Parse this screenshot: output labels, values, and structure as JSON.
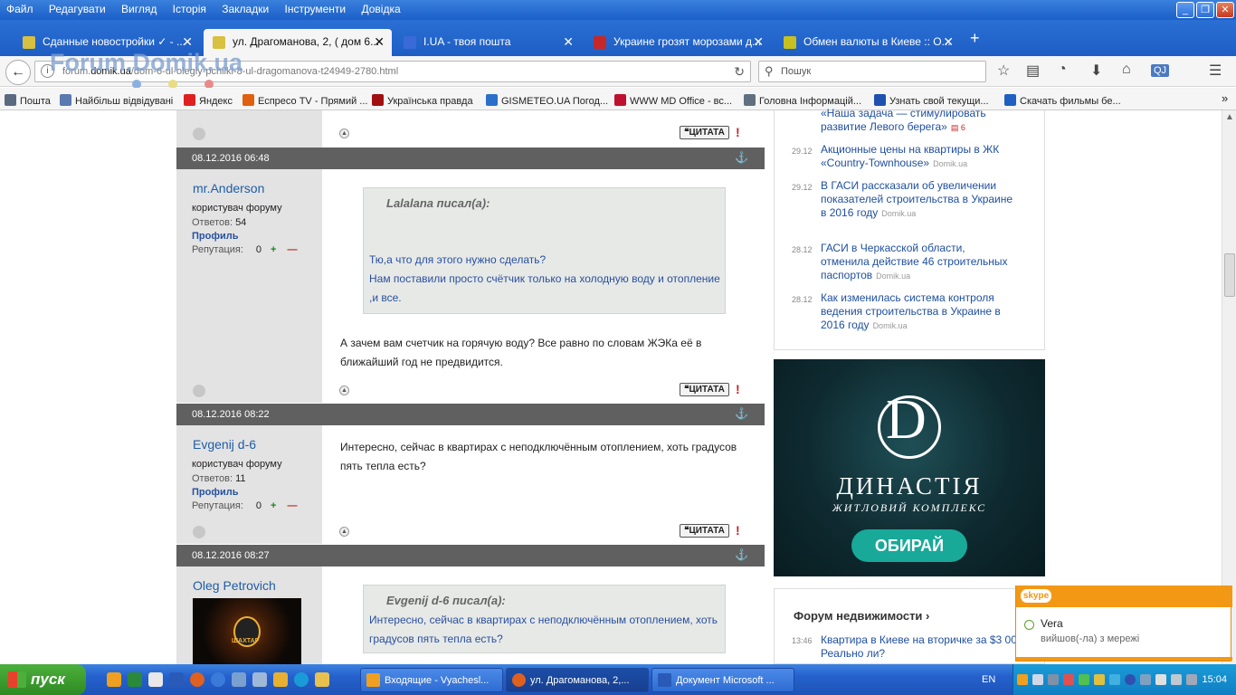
{
  "menu": [
    "Файл",
    "Редагувати",
    "Вигляд",
    "Історія",
    "Закладки",
    "Інструменти",
    "Довідка"
  ],
  "window_buttons": {
    "min": "_",
    "max": "❐",
    "close": "✕"
  },
  "tabs": [
    {
      "label": "Сданные новостройки ✓ - ...",
      "icon_color": "#d8c040"
    },
    {
      "label": "ул. Драгоманова, 2, ( дом 6...",
      "icon_color": "#d8c040"
    },
    {
      "label": "I.UA - твоя пошта",
      "icon_color": "#3a6ad8"
    },
    {
      "label": "Украине грозят морозами д...",
      "icon_color": "#c62828"
    },
    {
      "label": "Обмен валюты в Киеве :: О...",
      "icon_color": "#c8c020"
    }
  ],
  "tab_close": "✕",
  "new_tab": "+",
  "nav": {
    "back": "←",
    "info": "i",
    "url_prefix": "forum.",
    "url_domain": "domik.ua",
    "url_path": "/dom-6-ul-olegiy-pchilki-8-ul-dragomanova-t24949-2780.html",
    "reload": "↻",
    "search_placeholder": "Пошук",
    "search_icon": "⚲"
  },
  "toolbar_icons": [
    {
      "name": "star-icon",
      "glyph": "☆"
    },
    {
      "name": "reading-list-icon",
      "glyph": "▤"
    },
    {
      "name": "pocket-icon",
      "glyph": "◔"
    },
    {
      "name": "download-icon",
      "glyph": "⬇"
    },
    {
      "name": "home-icon",
      "glyph": "⌂"
    },
    {
      "name": "addon-icon",
      "glyph": "QJ"
    },
    {
      "name": "menu-icon",
      "glyph": "☰"
    }
  ],
  "bookmarks": [
    {
      "label": "Пошта",
      "color": "#5a6a80"
    },
    {
      "label": "Найбільш відвідувані",
      "color": "#5a7ab0"
    },
    {
      "label": "Яндекс",
      "color": "#e02020"
    },
    {
      "label": "Еспресо TV - Прямий ...",
      "color": "#e06010"
    },
    {
      "label": "Українська правда",
      "color": "#a01010"
    },
    {
      "label": "GISMETEO.UA Погод...",
      "color": "#2a70c8"
    },
    {
      "label": "WWW MD Office - вс...",
      "color": "#c01030"
    },
    {
      "label": "Головна  Інформацій...",
      "color": "#607080"
    },
    {
      "label": "Узнать свой текущи...",
      "color": "#2050b0"
    },
    {
      "label": "Скачать фильмы бе...",
      "color": "#2060c0"
    }
  ],
  "bookmarks_more": "»",
  "logo_text": "Forum.Domik.ua",
  "posts": [
    {
      "date": "08.12.2016 06:48",
      "author": "mr.Anderson",
      "role": "користувач форуму",
      "answers_label": "Ответов:",
      "answers": "54",
      "profile": "Профиль",
      "rep_label": "Репутация:",
      "rep": "0",
      "quote_author": "Lalalana писал(а):",
      "quote_lines": [
        "Тю,а что для этого нужно сделать?",
        "Нам поставили просто счётчик только на холодную воду и отопление ,и все."
      ],
      "text": "А зачем вам счетчик на горячую воду? Все равно по словам ЖЭКа её в ближайший год не предвидится."
    },
    {
      "date": "08.12.2016 08:22",
      "author": "Evgenij d-6",
      "role": "користувач форуму",
      "answers_label": "Ответов:",
      "answers": "11",
      "profile": "Профиль",
      "rep_label": "Репутация:",
      "rep": "0",
      "text": "Интересно, сейчас в квартирах с неподключённым отоплением, хоть градусов пять тепла есть?"
    },
    {
      "date": "08.12.2016 08:27",
      "author": "Oleg Petrovich",
      "avatar_text": "ШАХТАР",
      "quote_author": "Evgenij d-6 писал(а):",
      "quote_lines": [
        "Интересно, сейчас в квартирах с неподключённым отоплением, хоть градусов пять тепла есть?"
      ]
    }
  ],
  "post_ui": {
    "cita": "❝ЦИТАТА",
    "warn": "!",
    "anchor": "⚓",
    "up": "▲",
    "plus": "+",
    "minus": "—"
  },
  "news": [
    {
      "date": "",
      "title": "«Наша задача — стимулировать развитие Левого берега»",
      "count": "6"
    },
    {
      "date": "29.12",
      "title": "Акционные цены на квартиры в ЖК «Country-Townhouse»",
      "source": "Domik.ua"
    },
    {
      "date": "29.12",
      "title": "В ГАСИ рассказали об увеличении показателей строительства в Украине в 2016 году",
      "source": "Domik.ua"
    },
    {
      "date": "28.12",
      "title": "ГАСИ в Черкасской области, отменила действие 46 строительных паспортов",
      "source": "Domik.ua"
    },
    {
      "date": "28.12",
      "title": "Как изменилась система контроля ведения строительства в Украине в 2016 году",
      "source": "Domik.ua"
    }
  ],
  "ad": {
    "letter": "D",
    "name": "ДИНАСТІЯ",
    "sub": "ЖИТЛОВИЙ КОМПЛЕКС",
    "button": "ОБИРАЙ"
  },
  "forum_box": {
    "heading": "Форум недвижимости  ›",
    "date": "13:46",
    "title": "Квартира в Киеве на вторичке за $3 000. Реально ли?"
  },
  "skype": {
    "logo": "skype",
    "name": "Vera",
    "message": "вийшов(-ла) з мережі"
  },
  "taskbar": {
    "start": "пуск",
    "tasks": [
      {
        "label": "Входящие - Vyachesl...",
        "color": "#f0a020"
      },
      {
        "label": "ул. Драгоманова, 2,...",
        "color": "#e06020"
      },
      {
        "label": "Документ Microsoft ...",
        "color": "#2a5ab8"
      }
    ],
    "lang": "EN",
    "clock": "15:04"
  }
}
